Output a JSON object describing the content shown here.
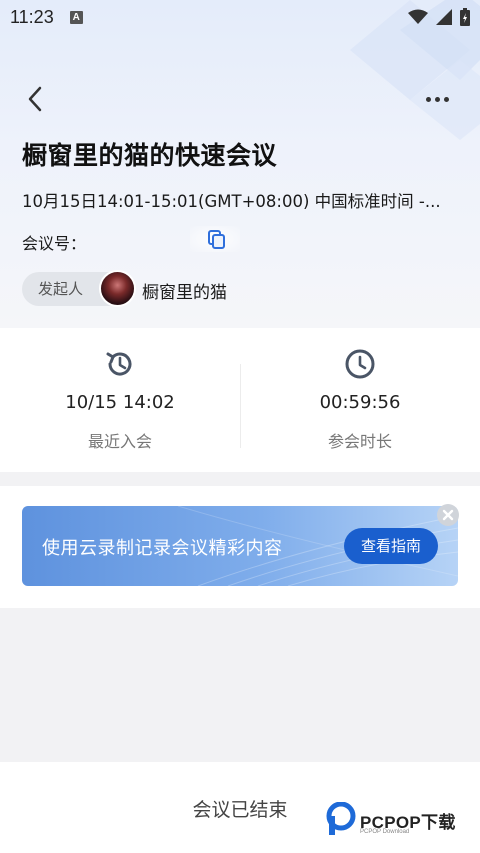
{
  "status_bar": {
    "time": "11:23",
    "notification_badge": "A"
  },
  "header": {
    "title": "橱窗里的猫的快速会议"
  },
  "meeting": {
    "time_range": "10月15日14:01-15:01(GMT+08:00) 中国标准时间 -...",
    "number_label": "会议号："
  },
  "host": {
    "tag_label": "发起人",
    "name": "橱窗里的猫"
  },
  "stats": {
    "recent_join": {
      "value": "10/15 14:02",
      "label": "最近入会"
    },
    "duration": {
      "value": "00:59:56",
      "label": "参会时长"
    }
  },
  "banner": {
    "text": "使用云录制记录会议精彩内容",
    "button_label": "查看指南"
  },
  "footer": {
    "status_text": "会议已结束"
  },
  "watermark": {
    "text": "PCPOP下载",
    "sub": "PCPOP Download"
  },
  "icons": {
    "back": "chevron-left-icon",
    "more": "more-icon",
    "copy": "copy-icon",
    "recent": "history-icon",
    "duration": "clock-icon",
    "close": "close-icon"
  },
  "colors": {
    "accent": "#1a5fce",
    "icon_gray": "#4a5566",
    "banner_start": "#5e92de"
  }
}
